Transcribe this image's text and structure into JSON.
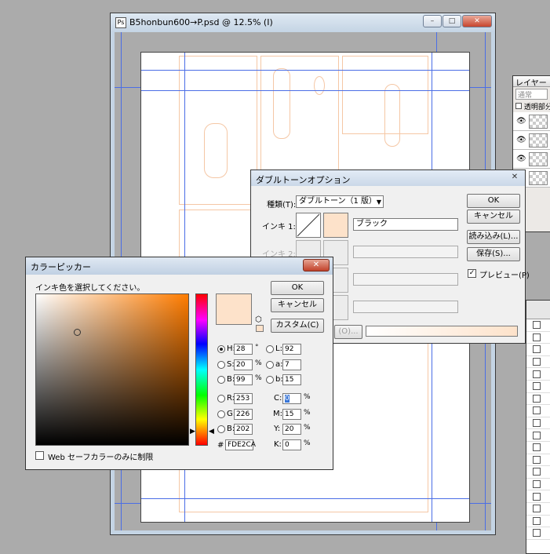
{
  "document": {
    "title": "B5honbun600→P.psd @ 12.5% (I)",
    "minimize": "–",
    "maximize": "□",
    "close": "✕"
  },
  "layers_panel": {
    "tab": "レイヤー",
    "blend_mode": "通常",
    "lock_transparent": "透明部分"
  },
  "duotone": {
    "title": "ダブルトーンオプション",
    "close": "✕",
    "type_label": "種類(T):",
    "type_value": "ダブルトーン（1 版）",
    "ink1_label": "インキ 1:",
    "ink1_name": "ブラック",
    "ink2_label": "インキ 2:",
    "ok": "OK",
    "cancel": "キャンセル",
    "load": "読み込み(L)...",
    "save": "保存(S)...",
    "preview_label": "プレビュー(P)",
    "preview_checked": true,
    "overprint_label": "(O)...",
    "ink_color": "#FDE2CA"
  },
  "picker": {
    "title": "カラーピッカー",
    "close": "✕",
    "prompt": "インキ色を選択してください。",
    "ok": "OK",
    "cancel": "キャンセル",
    "custom": "カスタム(C)",
    "web_only": "Web セーフカラーのみに制限",
    "fields": {
      "H": {
        "label": "H:",
        "value": "28",
        "unit": "°"
      },
      "S": {
        "label": "S:",
        "value": "20",
        "unit": "%"
      },
      "B": {
        "label": "B:",
        "value": "99",
        "unit": "%"
      },
      "R": {
        "label": "R:",
        "value": "253"
      },
      "G": {
        "label": "G:",
        "value": "226"
      },
      "Bb": {
        "label": "B:",
        "value": "202"
      },
      "L": {
        "label": "L:",
        "value": "92"
      },
      "a": {
        "label": "a:",
        "value": "7"
      },
      "b": {
        "label": "b:",
        "value": "15"
      },
      "C": {
        "label": "C:",
        "value": "0",
        "unit": "%"
      },
      "M": {
        "label": "M:",
        "value": "15",
        "unit": "%"
      },
      "Y": {
        "label": "Y:",
        "value": "20",
        "unit": "%"
      },
      "K": {
        "label": "K:",
        "value": "0",
        "unit": "%"
      }
    },
    "hex_label": "#",
    "hex_value": "FDE2CA",
    "current_color": "#FDE2CA"
  },
  "colors": {
    "guide": "#4b6ee6",
    "sketch": "#f5c7a5"
  }
}
